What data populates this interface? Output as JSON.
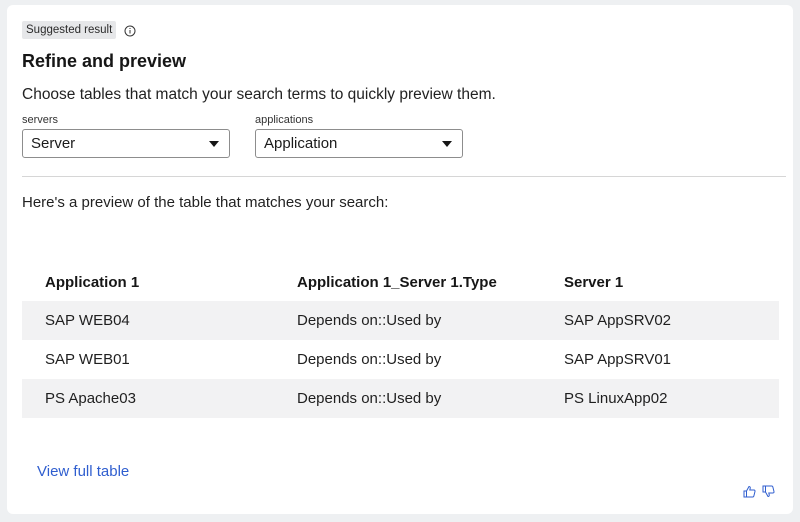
{
  "badge": {
    "label": "Suggested result"
  },
  "title": "Refine and preview",
  "subtitle": "Choose tables that match your search terms to quickly preview them.",
  "filters": [
    {
      "label": "servers",
      "value": "Server"
    },
    {
      "label": "applications",
      "value": "Application"
    }
  ],
  "preview_text": "Here's a preview of the table that matches your search:",
  "table": {
    "headers": [
      "Application 1",
      "Application 1_Server 1.Type",
      "Server 1"
    ],
    "rows": [
      [
        "SAP WEB04",
        "Depends on::Used by",
        "SAP AppSRV02"
      ],
      [
        "SAP WEB01",
        "Depends on::Used by",
        "SAP AppSRV01"
      ],
      [
        "PS Apache03",
        "Depends on::Used by",
        "PS LinuxApp02"
      ]
    ]
  },
  "view_full_table": "View full table",
  "icons": {
    "info": "info-icon",
    "dropdown": "chevron-down-icon",
    "thumbs_up": "thumbs-up-icon",
    "thumbs_down": "thumbs-down-icon"
  },
  "colors": {
    "link": "#2f5ecf",
    "row_shade": "#f2f2f3",
    "badge_bg": "#e6e7e9"
  }
}
